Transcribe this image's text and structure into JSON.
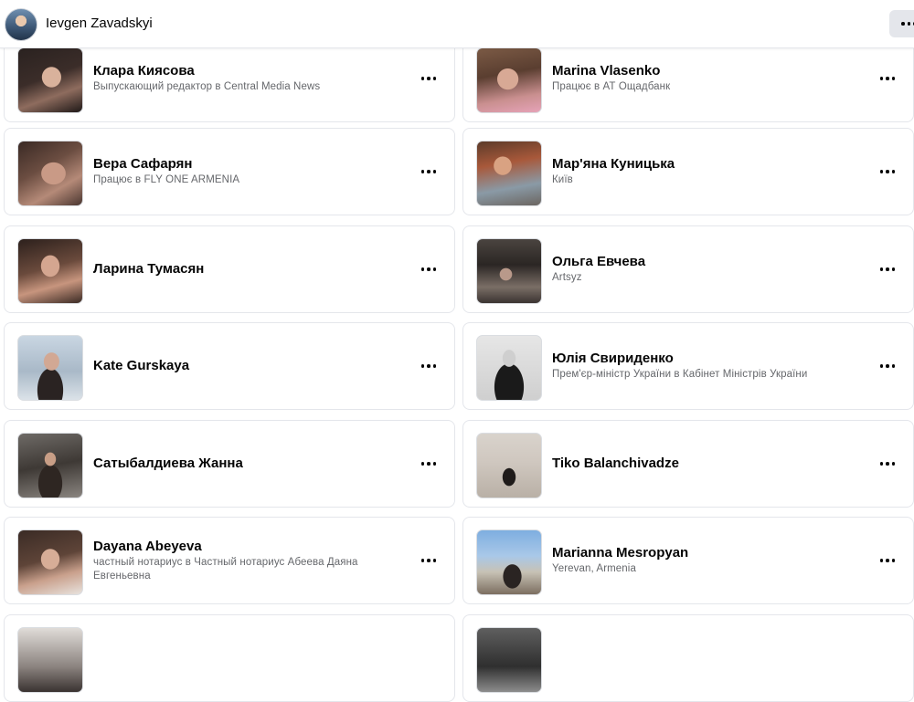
{
  "header": {
    "name": "Ievgen Zavadskyi",
    "more_icon": "more-horizontal-icon"
  },
  "cards": [
    {
      "name": "Клара Киясова",
      "subtitle": "Выпускающий редактор в Central Media News"
    },
    {
      "name": "Marina Vlasenko",
      "subtitle": "Працює в АТ Ощадбанк"
    },
    {
      "name": "Вера Сафарян",
      "subtitle": "Працює в FLY ONE ARMENIA"
    },
    {
      "name": "Мар'яна Куницька",
      "subtitle": "Київ"
    },
    {
      "name": "Ларина Тумасян",
      "subtitle": ""
    },
    {
      "name": "Ольга Евчева",
      "subtitle": "Artsyz"
    },
    {
      "name": "Kate Gurskaya",
      "subtitle": ""
    },
    {
      "name": "Юлія Свириденко",
      "subtitle": "Прем'єр-міністр України в Кабінет Міністрів України"
    },
    {
      "name": "Сатыбалдиева Жанна",
      "subtitle": ""
    },
    {
      "name": "Tiko Balanchivadze",
      "subtitle": ""
    },
    {
      "name": "Dayana Abeyeva",
      "subtitle": "частный нотариус в Частный нотариус Абеева Даяна Евгеньевна"
    },
    {
      "name": "Marianna Mesropyan",
      "subtitle": "Yerevan, Armenia"
    },
    {
      "name": "",
      "subtitle": ""
    },
    {
      "name": "",
      "subtitle": ""
    }
  ]
}
